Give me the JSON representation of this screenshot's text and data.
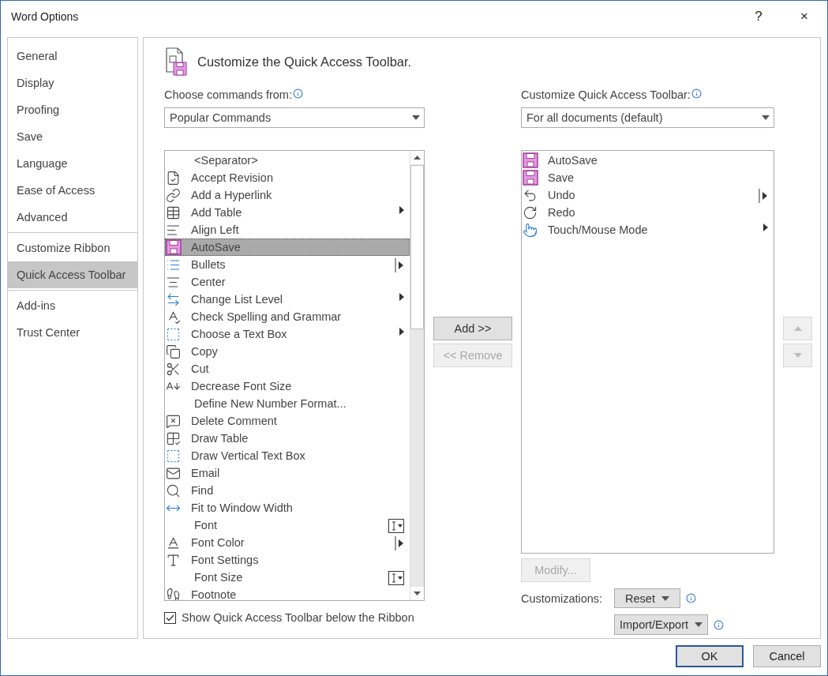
{
  "window": {
    "title": "Word Options",
    "help": "?",
    "close": "×"
  },
  "sidebar": {
    "sections": [
      {
        "items": [
          {
            "label": "General",
            "selected": false
          },
          {
            "label": "Display",
            "selected": false
          },
          {
            "label": "Proofing",
            "selected": false
          },
          {
            "label": "Save",
            "selected": false
          },
          {
            "label": "Language",
            "selected": false
          },
          {
            "label": "Ease of Access",
            "selected": false
          },
          {
            "label": "Advanced",
            "selected": false
          }
        ]
      },
      {
        "items": [
          {
            "label": "Customize Ribbon",
            "selected": false
          },
          {
            "label": "Quick Access Toolbar",
            "selected": true
          }
        ]
      },
      {
        "items": [
          {
            "label": "Add-ins",
            "selected": false
          },
          {
            "label": "Trust Center",
            "selected": false
          }
        ]
      }
    ]
  },
  "heading": "Customize the Quick Access Toolbar.",
  "commands": {
    "label": "Choose commands from:",
    "dropdown": "Popular Commands",
    "items": [
      {
        "label": "<Separator>",
        "kind": "plain",
        "selected": false
      },
      {
        "label": "Accept Revision",
        "kind": "plain",
        "selected": false
      },
      {
        "label": "Add a Hyperlink",
        "kind": "plain",
        "selected": false
      },
      {
        "label": "Add Table",
        "kind": "menu",
        "selected": false
      },
      {
        "label": "Align Left",
        "kind": "plain",
        "selected": false
      },
      {
        "label": "AutoSave",
        "kind": "plain",
        "selected": true
      },
      {
        "label": "Bullets",
        "kind": "split",
        "selected": false
      },
      {
        "label": "Center",
        "kind": "plain",
        "selected": false
      },
      {
        "label": "Change List Level",
        "kind": "menu",
        "selected": false
      },
      {
        "label": "Check Spelling and Grammar",
        "kind": "plain",
        "selected": false
      },
      {
        "label": "Choose a Text Box",
        "kind": "menu",
        "selected": false
      },
      {
        "label": "Copy",
        "kind": "plain",
        "selected": false
      },
      {
        "label": "Cut",
        "kind": "plain",
        "selected": false
      },
      {
        "label": "Decrease Font Size",
        "kind": "plain",
        "selected": false
      },
      {
        "label": "Define New Number Format...",
        "kind": "plain",
        "selected": false
      },
      {
        "label": "Delete Comment",
        "kind": "plain",
        "selected": false
      },
      {
        "label": "Draw Table",
        "kind": "plain",
        "selected": false
      },
      {
        "label": "Draw Vertical Text Box",
        "kind": "plain",
        "selected": false
      },
      {
        "label": "Email",
        "kind": "plain",
        "selected": false
      },
      {
        "label": "Find",
        "kind": "plain",
        "selected": false
      },
      {
        "label": "Fit to Window Width",
        "kind": "plain",
        "selected": false
      },
      {
        "label": "Font",
        "kind": "combo",
        "selected": false
      },
      {
        "label": "Font Color",
        "kind": "split",
        "selected": false
      },
      {
        "label": "Font Settings",
        "kind": "plain",
        "selected": false
      },
      {
        "label": "Font Size",
        "kind": "combo",
        "selected": false
      },
      {
        "label": "Footnote",
        "kind": "plain",
        "selected": false
      }
    ],
    "checkbox": {
      "label": "Show Quick Access Toolbar below the Ribbon",
      "checked": true
    }
  },
  "actions": {
    "add": {
      "label": "Add >>",
      "disabled": false
    },
    "remove": {
      "label": "<< Remove",
      "disabled": true
    }
  },
  "toolbar": {
    "label": "Customize Quick Access Toolbar:",
    "dropdown": "For all documents (default)",
    "items": [
      {
        "label": "AutoSave",
        "kind": "plain",
        "selected": false
      },
      {
        "label": "Save",
        "kind": "plain",
        "selected": false
      },
      {
        "label": "Undo",
        "kind": "split",
        "selected": false
      },
      {
        "label": "Redo",
        "kind": "plain",
        "selected": false
      },
      {
        "label": "Touch/Mouse Mode",
        "kind": "menu",
        "selected": false
      }
    ],
    "move_up": {
      "disabled": true
    },
    "move_down": {
      "disabled": true
    },
    "modify": {
      "label": "Modify...",
      "disabled": true
    },
    "customizations_label": "Customizations:",
    "reset": "Reset",
    "import_export": "Import/Export"
  },
  "footer": {
    "ok": "OK",
    "cancel": "Cancel"
  }
}
